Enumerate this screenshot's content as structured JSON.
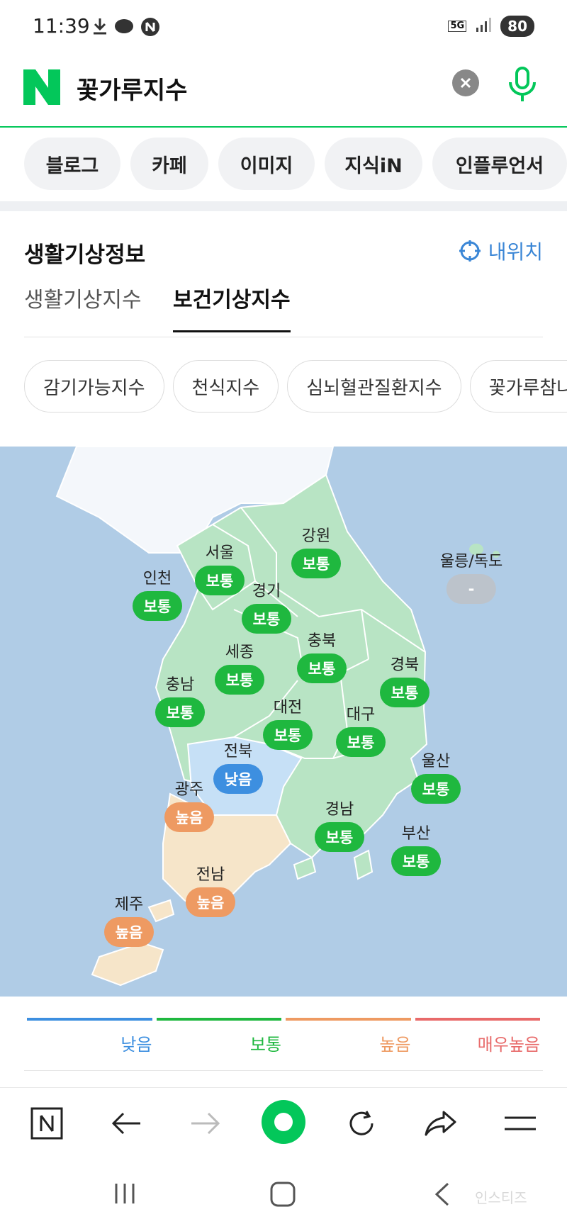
{
  "status_bar": {
    "time": "11:39",
    "network": "5G",
    "battery": "80"
  },
  "search": {
    "query": "꽃가루지수",
    "logo_letter": "N"
  },
  "categories": [
    "블로그",
    "카페",
    "이미지",
    "지식iN",
    "인플루언서"
  ],
  "section": {
    "title": "생활기상정보",
    "location_label": "내위치"
  },
  "tabs": [
    {
      "label": "생활기상지수"
    },
    {
      "label": "보건기상지수"
    }
  ],
  "sub_chips": [
    "감기가능지수",
    "천식지수",
    "심뇌혈관질환지수",
    "꽃가루참나"
  ],
  "map": {
    "regions": [
      {
        "name": "강원",
        "status": "보통"
      },
      {
        "name": "서울",
        "status": "보통"
      },
      {
        "name": "인천",
        "status": "보통"
      },
      {
        "name": "경기",
        "status": "보통"
      },
      {
        "name": "울릉/독도",
        "status": "-"
      },
      {
        "name": "충북",
        "status": "보통"
      },
      {
        "name": "세종",
        "status": "보통"
      },
      {
        "name": "경북",
        "status": "보통"
      },
      {
        "name": "충남",
        "status": "보통"
      },
      {
        "name": "대전",
        "status": "보통"
      },
      {
        "name": "대구",
        "status": "보통"
      },
      {
        "name": "전북",
        "status": "낮음"
      },
      {
        "name": "광주",
        "status": "높음"
      },
      {
        "name": "울산",
        "status": "보통"
      },
      {
        "name": "경남",
        "status": "보통"
      },
      {
        "name": "부산",
        "status": "보통"
      },
      {
        "name": "전남",
        "status": "높음"
      },
      {
        "name": "제주",
        "status": "높음"
      }
    ]
  },
  "legend": [
    {
      "label": "낮음",
      "color": "#3d8fe0"
    },
    {
      "label": "보통",
      "color": "#1fb83f"
    },
    {
      "label": "높음",
      "color": "#ee9a62"
    },
    {
      "label": "매우높음",
      "color": "#e86a6a"
    }
  ],
  "watermark": "인스티즈"
}
